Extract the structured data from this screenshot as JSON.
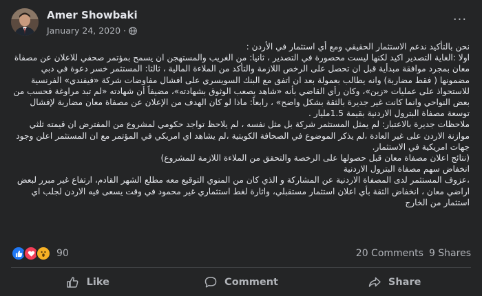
{
  "post": {
    "author": "Amer Showbaki",
    "date": "January 24, 2020",
    "separator": "·",
    "more_label": "···",
    "paragraphs": [
      "نحن بالتأكيد ندعم الاستثمار الحقيقي ومع أي استثمار في الأردن :",
      "اولا :الغاية التصدير اكيد لكنها ليست محصورة في التصدير ، ثانيا: من الغريب والمستهجن ان يسمح بمؤتمر صحفي للاعلان عن مصفاة معان بمجرد موافقة مبدأية قبل ان تحصل على الرخص اللازمة والتأكد من الملاءة المالية ، ثالثا: المستثمر خسر دعوة في دبي مضمونها ( فقط مضاربة) وانه يطالب بعمولة بعد ان اتفق مع البنك السويسري على افشال مفاوضات شركة «فيفندي» الفرنسية للاستحواذ على عمليات «زين»، وكان رأي القاضي بأنه «شاهد يصعب الوثوق بشهادته»، مضيفاً أن شهادته «لم تبد مراوغة فحسب من بعض النواحي وانما كانت غير جديرة بالثقة بشكل واضح» ، رابعاً: ماذا لو كان الهدف من الإعلان عن مصفاة معان مضاربة لإفشال توسعة مصفاة البترول الاردنية بقيمة 1.5مليار .",
      "ملاحظات جديرة بالاعتبار: لم يمثل المستثمر شركة بل مثل نفسه ، لم يلاحظ تواجد حكومي لمشروع من المفترض ان قيمته ثلثي موازنة الاردن على غير العادة ،لم يذكر الموضوع في الصحافة الكويتية ،لم يشاهد اي امريكي في المؤتمر مع ان المستثمر اعلن وجود جهات امريكية في الاستثمار.",
      "(نتائج اعلان مصفاة معان قبل حصولها على الرخصة والتحقق من الملاءة اللازمة للمشروع)",
      "انخفاض سهم مصفاة البترول الاردنية",
      "،عزوف المستثمر لدى المصفاة الاردنية عن المشاركة و الذي كان من المنوي التوقيع معه مطلع الشهر القادم، ارتفاع غير مبرر لبعض اراضي معان ، انخفاض الثقة بأي اعلان استثمار مستقبلي، واثارة لغط استثماري غير محمود في وقت يسعى فيه الاردن لجلب اي استثمار من الخارج"
    ]
  },
  "stats": {
    "reaction_count": "90",
    "comments": "20 Comments",
    "shares": "9 Shares",
    "reaction_icons": [
      "like-icon",
      "love-icon",
      "wow-icon"
    ]
  },
  "actions": {
    "like": "Like",
    "comment": "Comment",
    "share": "Share"
  },
  "colors": {
    "background": "#242526",
    "text": "#e4e6eb",
    "secondary_text": "#b0b3b8",
    "like_blue": "#2078f4",
    "love_red": "#f33e58",
    "wow_yellow": "#f7b125"
  }
}
